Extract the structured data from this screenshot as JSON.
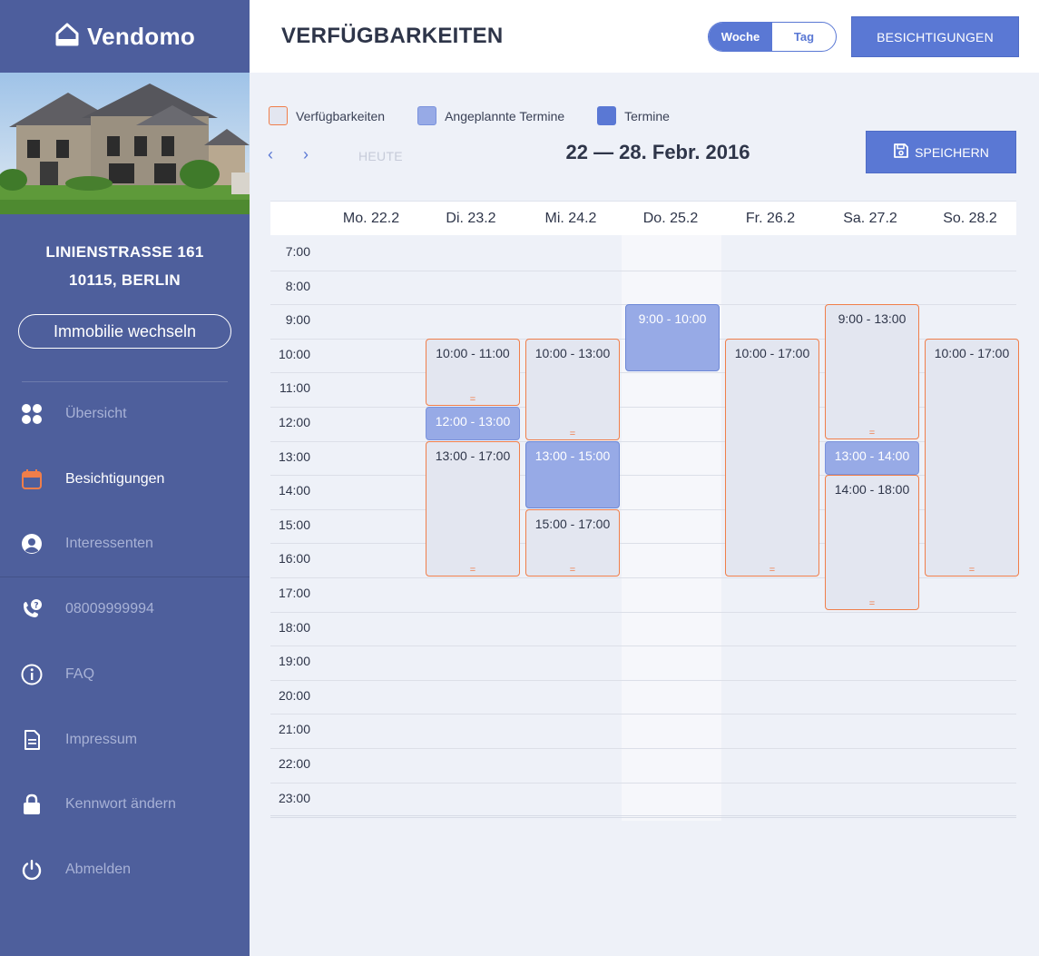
{
  "app": {
    "name": "Vendomo"
  },
  "sidebar": {
    "address_line1": "LINIENSTRASSE 161",
    "address_line2": "10115, BERLIN",
    "switch_label": "Immobilie wechseln",
    "nav": [
      {
        "label": "Übersicht",
        "icon": "grid-dots-icon",
        "active": false
      },
      {
        "label": "Besichtigungen",
        "icon": "calendar-icon",
        "active": true
      },
      {
        "label": "Interessenten",
        "icon": "user-circle-icon",
        "active": false
      },
      {
        "label": "08009999994",
        "icon": "phone-question-icon",
        "active": false
      },
      {
        "label": "FAQ",
        "icon": "info-icon",
        "active": false
      },
      {
        "label": "Impressum",
        "icon": "document-icon",
        "active": false
      },
      {
        "label": "Kennwort ändern",
        "icon": "lock-icon",
        "active": false
      },
      {
        "label": "Abmelden",
        "icon": "power-icon",
        "active": false
      }
    ]
  },
  "header": {
    "title": "VERFÜGBARKEITEN",
    "view_toggle": {
      "week": "Woche",
      "day": "Tag",
      "selected": "Woche"
    },
    "button": "BESICHTIGUNGEN"
  },
  "legend": [
    {
      "label": "Verfügbarkeiten",
      "type": "avail"
    },
    {
      "label": "Angeplannte Termine",
      "type": "planned"
    },
    {
      "label": "Termine",
      "type": "termin"
    }
  ],
  "toolbar": {
    "prev": "‹",
    "next": "›",
    "today": "HEUTE",
    "range": "22 — 28. Febr. 2016",
    "save": "SPEICHERN"
  },
  "calendar": {
    "days": [
      "Mo. 22.2",
      "Di. 23.2",
      "Mi. 24.2",
      "Do. 25.2",
      "Fr. 26.2",
      "Sa. 27.2",
      "So. 28.2"
    ],
    "highlight_day": 3,
    "hours": [
      "7:00",
      "8:00",
      "9:00",
      "10:00",
      "11:00",
      "12:00",
      "13:00",
      "14:00",
      "15:00",
      "16:00",
      "17:00",
      "18:00",
      "19:00",
      "20:00",
      "21:00",
      "22:00",
      "23:00"
    ],
    "events": [
      {
        "day": 1,
        "start": 10,
        "end": 12,
        "label": "10:00 - 11:00",
        "type": "avail",
        "handle": true
      },
      {
        "day": 1,
        "start": 12,
        "end": 13,
        "label": "12:00 - 13:00",
        "type": "planned",
        "handle": false
      },
      {
        "day": 1,
        "start": 13,
        "end": 17,
        "label": "13:00 - 17:00",
        "type": "avail",
        "handle": true
      },
      {
        "day": 2,
        "start": 10,
        "end": 13,
        "label": "10:00 - 13:00",
        "type": "avail",
        "handle": true
      },
      {
        "day": 2,
        "start": 13,
        "end": 15,
        "label": "13:00 - 15:00",
        "type": "blue",
        "handle": false
      },
      {
        "day": 2,
        "start": 15,
        "end": 17,
        "label": "15:00 - 17:00",
        "type": "avail",
        "handle": true
      },
      {
        "day": 3,
        "start": 9,
        "end": 11,
        "label": "9:00 - 10:00",
        "type": "blue",
        "handle": false
      },
      {
        "day": 4,
        "start": 10,
        "end": 17,
        "label": "10:00 - 17:00",
        "type": "avail",
        "handle": true
      },
      {
        "day": 5,
        "start": 9,
        "end": 13,
        "label": "9:00 - 13:00",
        "type": "avail",
        "handle": true
      },
      {
        "day": 5,
        "start": 13,
        "end": 14,
        "label": "13:00 - 14:00",
        "type": "planned",
        "handle": false
      },
      {
        "day": 5,
        "start": 14,
        "end": 18,
        "label": "14:00 - 18:00",
        "type": "avail",
        "handle": true
      },
      {
        "day": 6,
        "start": 10,
        "end": 17,
        "label": "10:00 - 17:00",
        "type": "avail",
        "handle": true
      }
    ],
    "handle_glyph": "="
  }
}
